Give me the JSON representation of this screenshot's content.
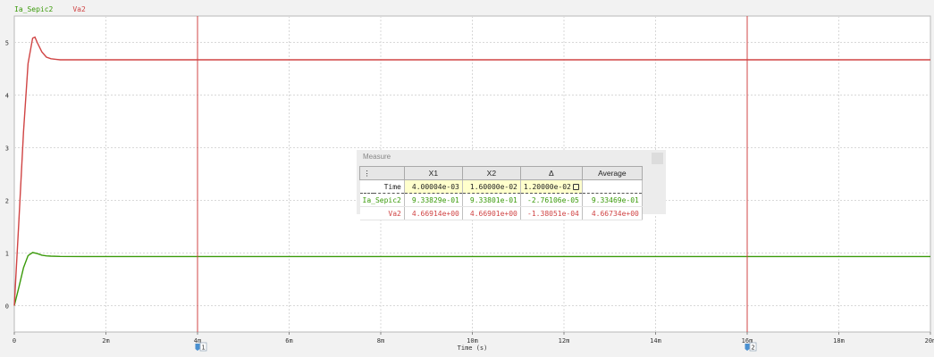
{
  "chart_data": {
    "type": "line",
    "xlabel": "Time (s)",
    "ylabel": "",
    "xlim": [
      0,
      0.02
    ],
    "ylim": [
      -0.5,
      5.5
    ],
    "x_tick_labels": [
      "0",
      "2m",
      "4m",
      "6m",
      "8m",
      "10m",
      "12m",
      "14m",
      "16m",
      "18m",
      "20m"
    ],
    "x_tick_values": [
      0,
      0.002,
      0.004,
      0.006,
      0.008,
      0.01,
      0.012,
      0.014,
      0.016,
      0.018,
      0.02
    ],
    "y_tick_labels": [
      "0",
      "1",
      "2",
      "3",
      "4",
      "5"
    ],
    "y_tick_values": [
      0,
      1,
      2,
      3,
      4,
      5
    ],
    "grid": true,
    "legend": "top-left",
    "series": [
      {
        "name": "Ia_Sepic2",
        "color": "#3a9a0a",
        "x": [
          0,
          0.0001,
          0.0002,
          0.0003,
          0.0004,
          0.0005,
          0.0006,
          0.0007,
          0.0008,
          0.001,
          0.0015,
          0.02
        ],
        "y": [
          0,
          0.35,
          0.72,
          0.95,
          1.01,
          0.99,
          0.96,
          0.945,
          0.94,
          0.935,
          0.934,
          0.934
        ]
      },
      {
        "name": "Va2",
        "color": "#d04444",
        "x": [
          0,
          0.0001,
          0.0002,
          0.0003,
          0.0004,
          0.00045,
          0.0005,
          0.0006,
          0.0007,
          0.0008,
          0.0009,
          0.001,
          0.0012,
          0.02
        ],
        "y": [
          0,
          1.6,
          3.3,
          4.6,
          5.08,
          5.1,
          5.0,
          4.82,
          4.72,
          4.69,
          4.68,
          4.67,
          4.669,
          4.669
        ]
      }
    ],
    "cursors": [
      {
        "label": "1",
        "x": 0.004,
        "color": "#d04444"
      },
      {
        "label": "2",
        "x": 0.016,
        "color": "#d04444"
      }
    ]
  },
  "legend": {
    "items": [
      {
        "label": "Ia_Sepic2",
        "color": "#3a9a0a"
      },
      {
        "label": "Va2",
        "color": "#d04444"
      }
    ]
  },
  "measure": {
    "title": "Measure",
    "headers": {
      "x1": "X1",
      "x2": "X2",
      "delta": "Δ",
      "average": "Average"
    },
    "rows": [
      {
        "label": "Time",
        "x1": "4.00004e-03",
        "x2": "1.60000e-02",
        "delta": "1.20000e-02",
        "average": "",
        "color": "#222222"
      },
      {
        "label": "Ia_Sepic2",
        "x1": "9.33829e-01",
        "x2": "9.33801e-01",
        "delta": "-2.76106e-05",
        "average": "9.33469e-01",
        "color": "#3a9a0a"
      },
      {
        "label": "Va2",
        "x1": "4.66914e+00",
        "x2": "4.66901e+00",
        "delta": "-1.38051e-04",
        "average": "4.66734e+00",
        "color": "#d04444"
      }
    ]
  }
}
